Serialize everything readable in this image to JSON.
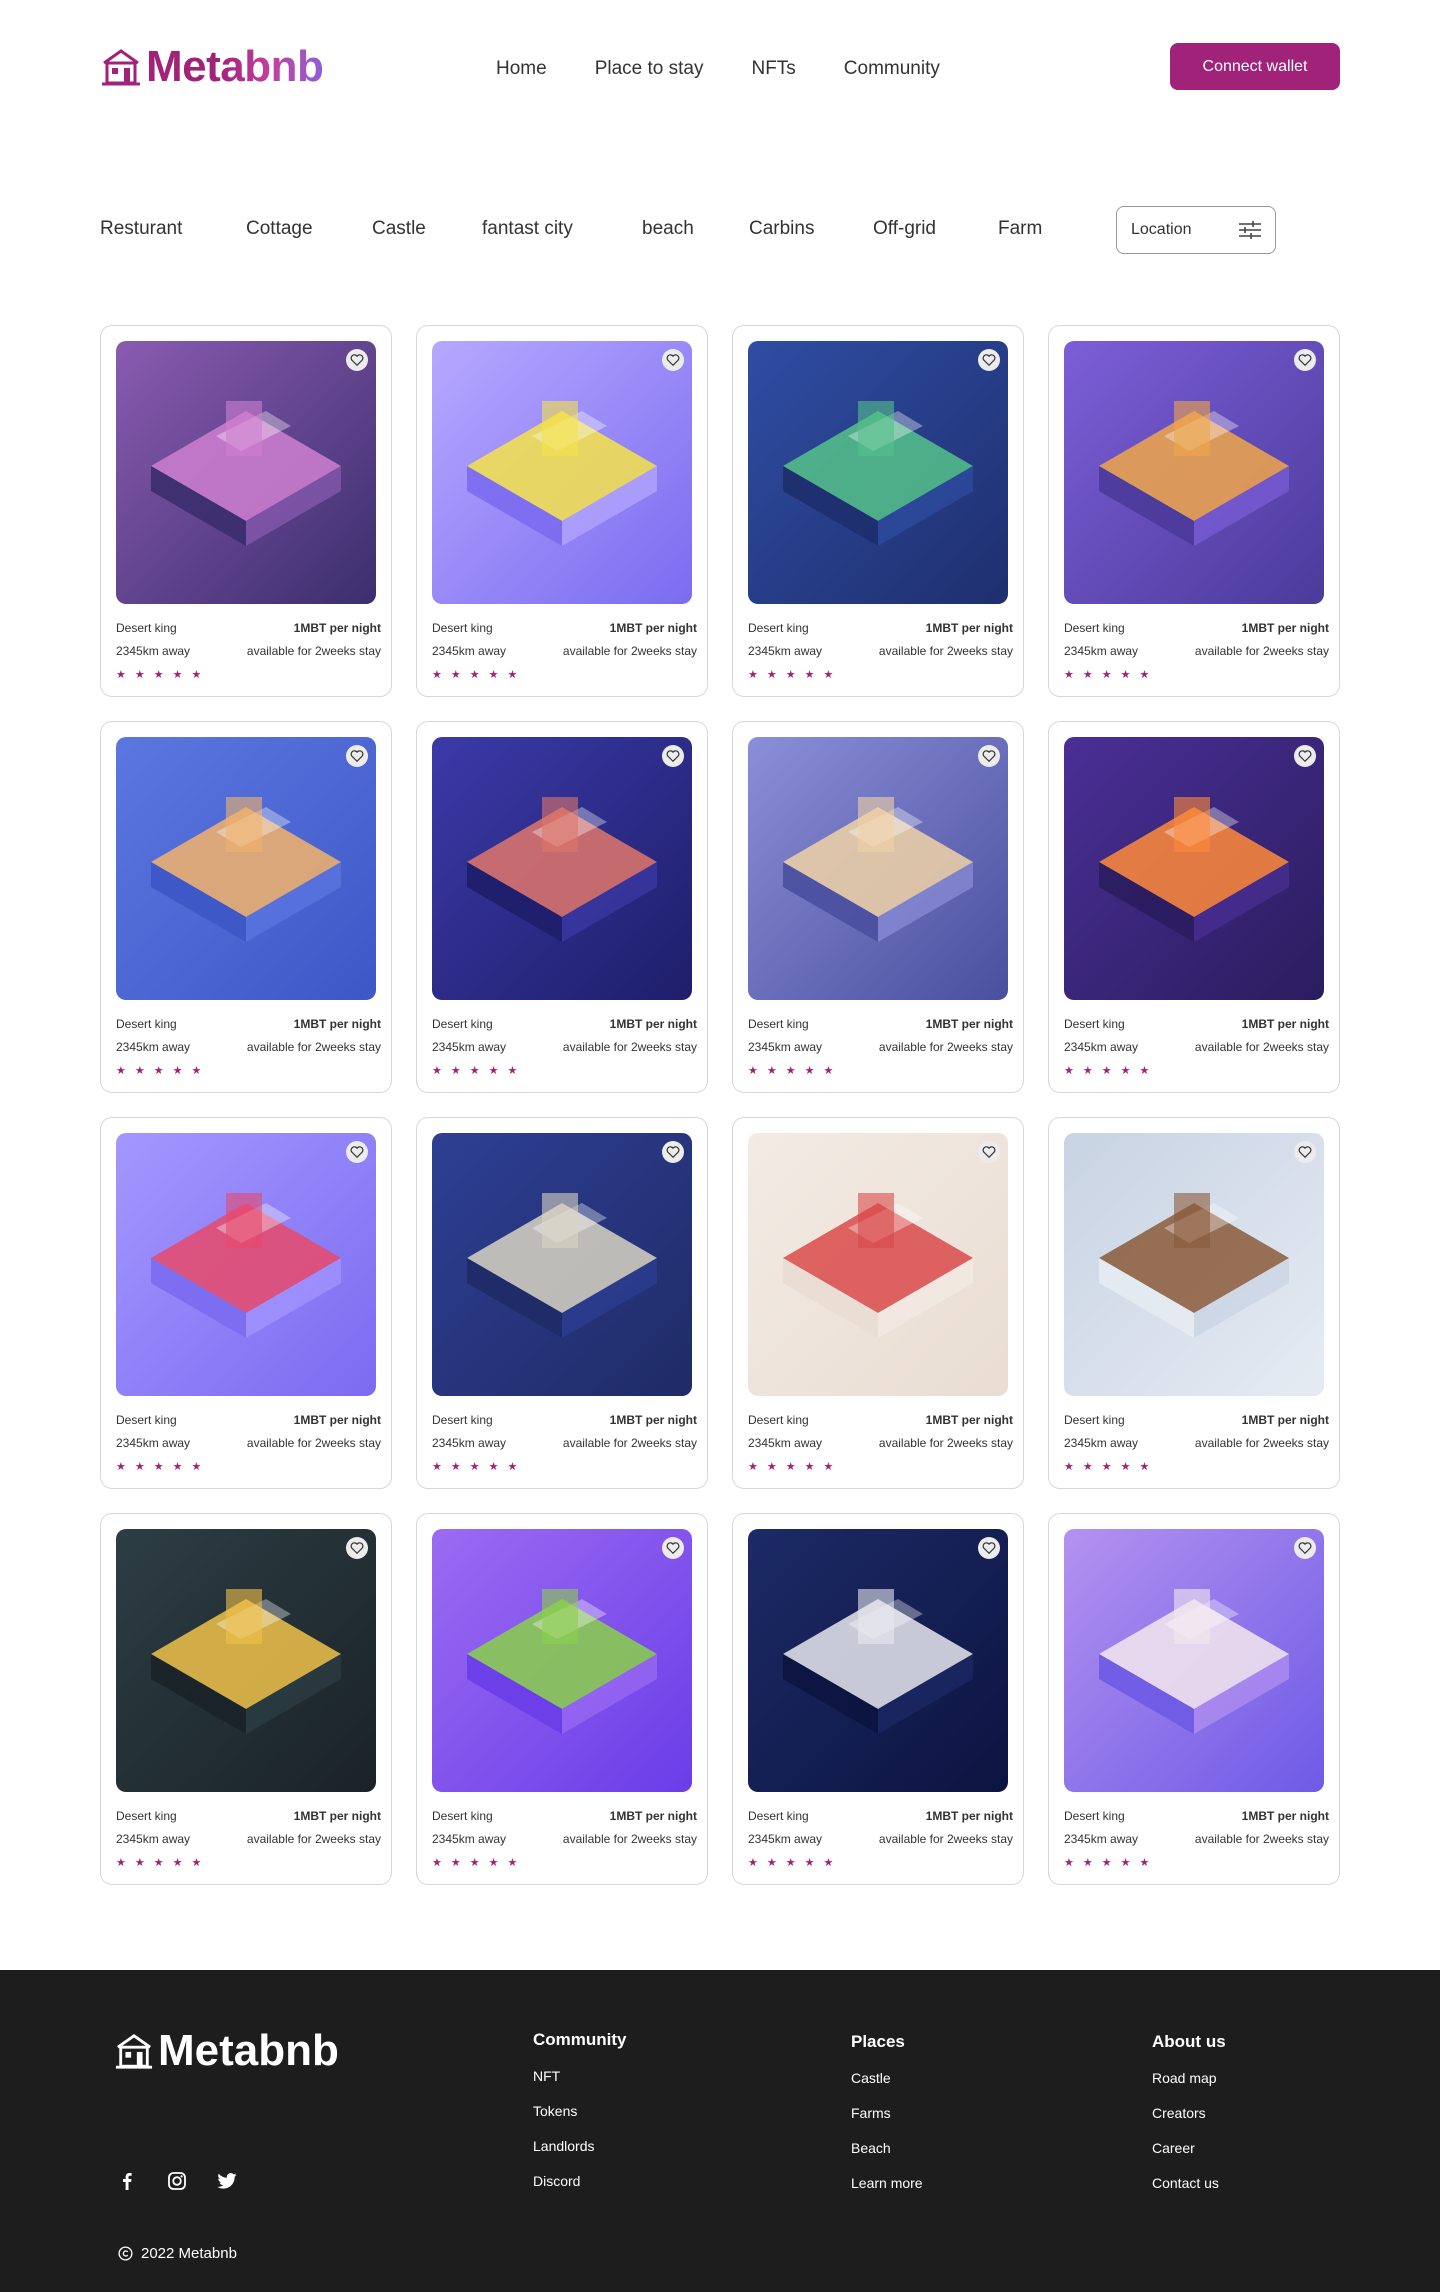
{
  "brand": {
    "name": "Metabnb",
    "accent": "#a02279",
    "footer_bg": "#1d1d1d"
  },
  "nav": {
    "items": [
      "Home",
      "Place to stay",
      "NFTs",
      "Community"
    ]
  },
  "connect_wallet": {
    "label": "Connect wallet"
  },
  "categories": [
    "Resturant",
    "Cottage",
    "Castle",
    "fantast city",
    "beach",
    "Carbins",
    "Off-grid",
    "Farm"
  ],
  "location_filter": {
    "label": "Location",
    "icon": "sliders-icon"
  },
  "listings": [
    {
      "name": "Desert king",
      "price": "1MBT per night",
      "distance": "2345km away",
      "availability": "available for 2weeks stay",
      "rating": 5
    },
    {
      "name": "Desert king",
      "price": "1MBT per night",
      "distance": "2345km away",
      "availability": "available for 2weeks stay",
      "rating": 5
    },
    {
      "name": "Desert king",
      "price": "1MBT per night",
      "distance": "2345km away",
      "availability": "available for 2weeks stay",
      "rating": 5
    },
    {
      "name": "Desert king",
      "price": "1MBT per night",
      "distance": "2345km away",
      "availability": "available for 2weeks stay",
      "rating": 5
    },
    {
      "name": "Desert king",
      "price": "1MBT per night",
      "distance": "2345km away",
      "availability": "available for 2weeks stay",
      "rating": 5
    },
    {
      "name": "Desert king",
      "price": "1MBT per night",
      "distance": "2345km away",
      "availability": "available for 2weeks stay",
      "rating": 5
    },
    {
      "name": "Desert king",
      "price": "1MBT per night",
      "distance": "2345km away",
      "availability": "available for 2weeks stay",
      "rating": 5
    },
    {
      "name": "Desert king",
      "price": "1MBT per night",
      "distance": "2345km away",
      "availability": "available for 2weeks stay",
      "rating": 5
    },
    {
      "name": "Desert king",
      "price": "1MBT per night",
      "distance": "2345km away",
      "availability": "available for 2weeks stay",
      "rating": 5
    },
    {
      "name": "Desert king",
      "price": "1MBT per night",
      "distance": "2345km away",
      "availability": "available for 2weeks stay",
      "rating": 5
    },
    {
      "name": "Desert king",
      "price": "1MBT per night",
      "distance": "2345km away",
      "availability": "available for 2weeks stay",
      "rating": 5
    },
    {
      "name": "Desert king",
      "price": "1MBT per night",
      "distance": "2345km away",
      "availability": "available for 2weeks stay",
      "rating": 5
    },
    {
      "name": "Desert king",
      "price": "1MBT per night",
      "distance": "2345km away",
      "availability": "available for 2weeks stay",
      "rating": 5
    },
    {
      "name": "Desert king",
      "price": "1MBT per night",
      "distance": "2345km away",
      "availability": "available for 2weeks stay",
      "rating": 5
    },
    {
      "name": "Desert king",
      "price": "1MBT per night",
      "distance": "2345km away",
      "availability": "available for 2weeks stay",
      "rating": 5
    },
    {
      "name": "Desert king",
      "price": "1MBT per night",
      "distance": "2345km away",
      "availability": "available for 2weeks stay",
      "rating": 5
    }
  ],
  "footer": {
    "brand": "Metabnb",
    "columns": [
      {
        "title": "Community",
        "links": [
          "NFT",
          "Tokens",
          "Landlords",
          "Discord"
        ]
      },
      {
        "title": "Places",
        "links": [
          "Castle",
          "Farms",
          "Beach",
          "Learn more"
        ]
      },
      {
        "title": "About us",
        "links": [
          "Road map",
          "Creators",
          "Career",
          "Contact us"
        ]
      }
    ],
    "socials": [
      "facebook-icon",
      "instagram-icon",
      "twitter-icon"
    ],
    "copyright": "2022 Metabnb"
  }
}
